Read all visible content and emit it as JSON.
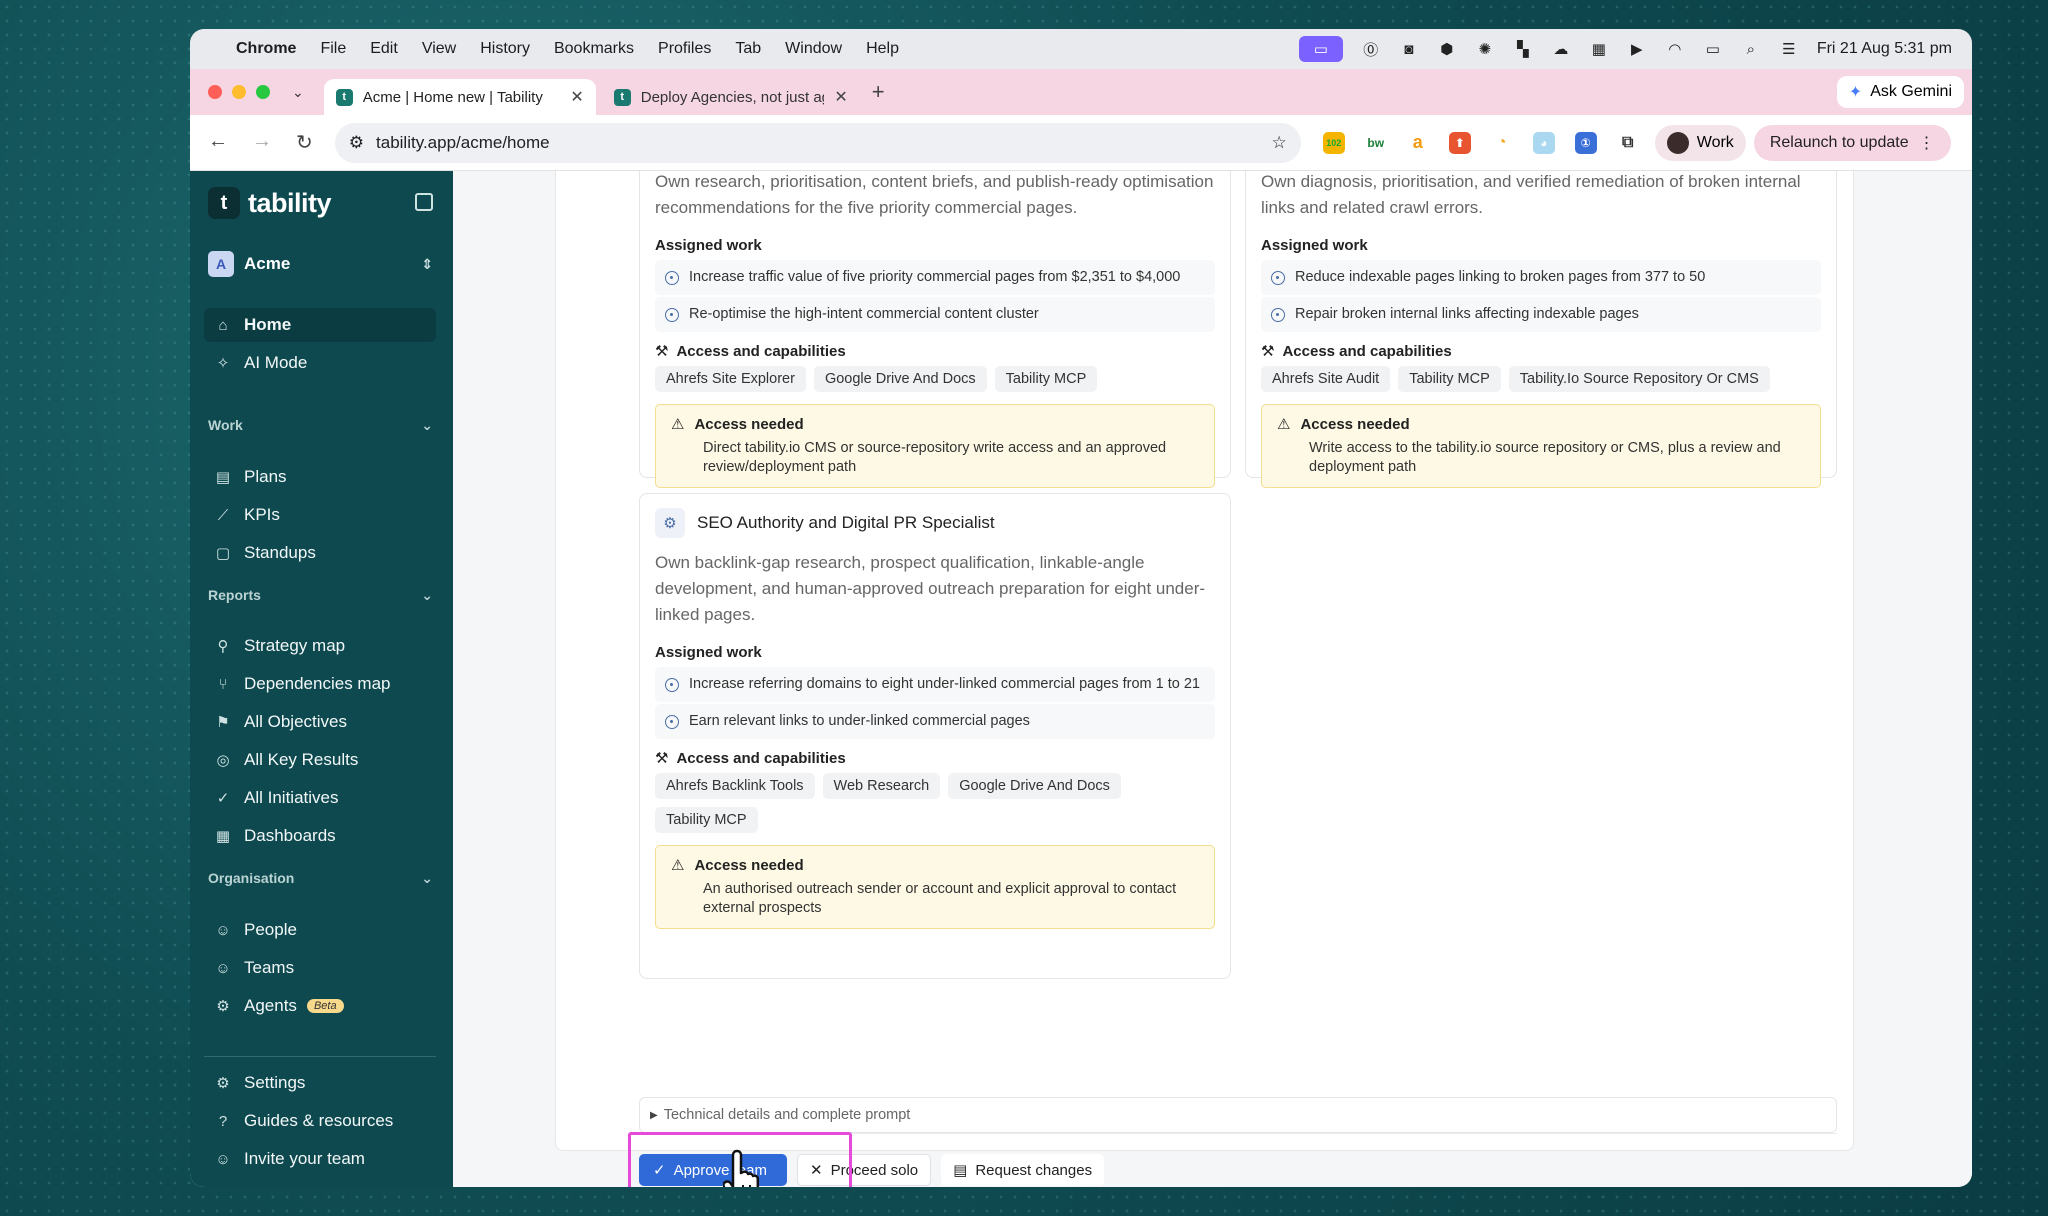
{
  "menubar": {
    "app": "Chrome",
    "items": [
      "File",
      "Edit",
      "View",
      "History",
      "Bookmarks",
      "Profiles",
      "Tab",
      "Window",
      "Help"
    ],
    "datetime": "Fri 21 Aug  5:31 pm"
  },
  "browser": {
    "tabs": [
      {
        "title": "Acme | Home new | Tability"
      },
      {
        "title": "Deploy Agencies, not just agents"
      }
    ],
    "ask_gemini": "Ask Gemini",
    "url": "tability.app/acme/home",
    "ext_badge": "102",
    "profile": "Work",
    "relaunch": "Relaunch to update"
  },
  "sidebar": {
    "logo": "tability",
    "workspace": "Acme",
    "top": [
      {
        "label": "Home",
        "icon": "home-icon"
      },
      {
        "label": "AI Mode",
        "icon": "sparkle-icon"
      }
    ],
    "work_title": "Work",
    "work": [
      {
        "label": "Plans"
      },
      {
        "label": "KPIs"
      },
      {
        "label": "Standups"
      }
    ],
    "reports_title": "Reports",
    "reports": [
      {
        "label": "Strategy map"
      },
      {
        "label": "Dependencies map"
      },
      {
        "label": "All Objectives"
      },
      {
        "label": "All Key Results"
      },
      {
        "label": "All Initiatives"
      },
      {
        "label": "Dashboards"
      }
    ],
    "org_title": "Organisation",
    "org": [
      {
        "label": "People"
      },
      {
        "label": "Teams"
      },
      {
        "label": "Agents"
      }
    ],
    "beta": "Beta",
    "bottom": [
      {
        "label": "Settings"
      },
      {
        "label": "Guides & resources"
      },
      {
        "label": "Invite your team"
      }
    ]
  },
  "cards": {
    "left_top": {
      "desc": "Own research, prioritisation, content briefs, and publish-ready optimisation recommendations for the five priority commercial pages.",
      "assigned_title": "Assigned work",
      "work": [
        "Increase traffic value of five priority commercial pages from $2,351 to $4,000",
        "Re-optimise the high-intent commercial content cluster"
      ],
      "access_title": "Access and capabilities",
      "chips": [
        "Ahrefs Site Explorer",
        "Google Drive And Docs",
        "Tability MCP"
      ],
      "needed_title": "Access needed",
      "needed": "Direct tability.io CMS or source-repository write access and an approved review/deployment path"
    },
    "right_top": {
      "desc": "Own diagnosis, prioritisation, and verified remediation of broken internal links and related crawl errors.",
      "assigned_title": "Assigned work",
      "work": [
        "Reduce indexable pages linking to broken pages from 377 to 50",
        "Repair broken internal links affecting indexable pages"
      ],
      "access_title": "Access and capabilities",
      "chips": [
        "Ahrefs Site Audit",
        "Tability MCP",
        "Tability.Io Source Repository Or CMS"
      ],
      "needed_title": "Access needed",
      "needed": "Write access to the tability.io source repository or CMS, plus a review and deployment path"
    },
    "seo": {
      "title": "SEO Authority and Digital PR Specialist",
      "desc": "Own backlink-gap research, prospect qualification, linkable-angle development, and human-approved outreach preparation for eight under-linked pages.",
      "assigned_title": "Assigned work",
      "work": [
        "Increase referring domains to eight under-linked commercial pages from 1 to 21",
        "Earn relevant links to under-linked commercial pages"
      ],
      "access_title": "Access and capabilities",
      "chips": [
        "Ahrefs Backlink Tools",
        "Web Research",
        "Google Drive And Docs",
        "Tability MCP"
      ],
      "needed_title": "Access needed",
      "needed": "An authorised outreach sender or account and explicit approval to contact external prospects"
    }
  },
  "tech_details": "Technical details and complete prompt",
  "actions": {
    "approve": "Approve team",
    "solo": "Proceed solo",
    "changes": "Request changes"
  }
}
